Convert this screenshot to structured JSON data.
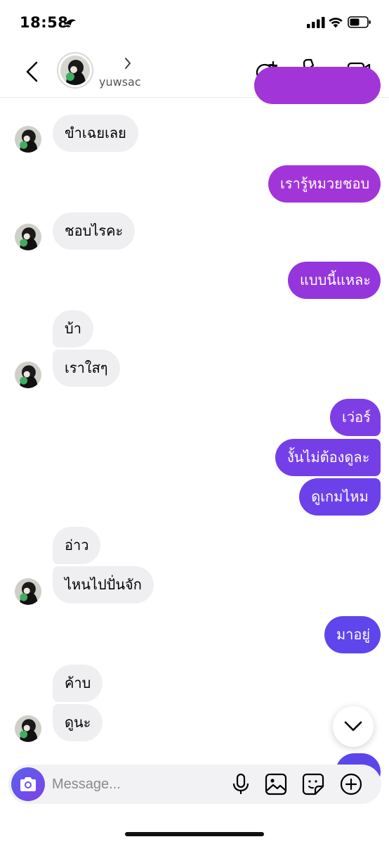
{
  "status": {
    "time": "18:58"
  },
  "header": {
    "username": "yuwsac"
  },
  "messages": [
    {
      "text": "ขำเฉยเลย",
      "side": "in"
    },
    {
      "text": "เรารู้หมวยชอบ",
      "side": "out"
    },
    {
      "text": "ชอบไรคะ",
      "side": "in"
    },
    {
      "text": "แบบนี้แหละ",
      "side": "out"
    },
    {
      "text": "บ้า",
      "side": "in"
    },
    {
      "text": "เราใสๆ",
      "side": "in"
    },
    {
      "text": "เว่อร์",
      "side": "out"
    },
    {
      "text": "งั้นไม่ต้องดูละ",
      "side": "out"
    },
    {
      "text": "ดูเกมไหม",
      "side": "out"
    },
    {
      "text": "อ่าว",
      "side": "in"
    },
    {
      "text": "ไหนไปปั่นจัก",
      "side": "in"
    },
    {
      "text": "มาอยู่",
      "side": "out"
    },
    {
      "text": "ค้าบ",
      "side": "in"
    },
    {
      "text": "ดูนะ",
      "side": "in"
    }
  ],
  "composer": {
    "placeholder": "Message..."
  },
  "colors": {
    "gradient_top": "#a235d8",
    "gradient_mid": "#7a3ee6",
    "gradient_bottom": "#5b46ec",
    "incoming_bubble": "#efeff2"
  },
  "icons": {
    "header": [
      "back-chevron-icon",
      "chevron-right-icon",
      "add-people-icon",
      "phone-icon",
      "video-camera-icon"
    ],
    "composer": [
      "camera-icon",
      "microphone-icon",
      "gallery-icon",
      "sticker-icon",
      "plus-circle-icon"
    ],
    "status": [
      "moon-icon",
      "cellular-signal-icon",
      "wifi-icon",
      "battery-icon"
    ]
  }
}
